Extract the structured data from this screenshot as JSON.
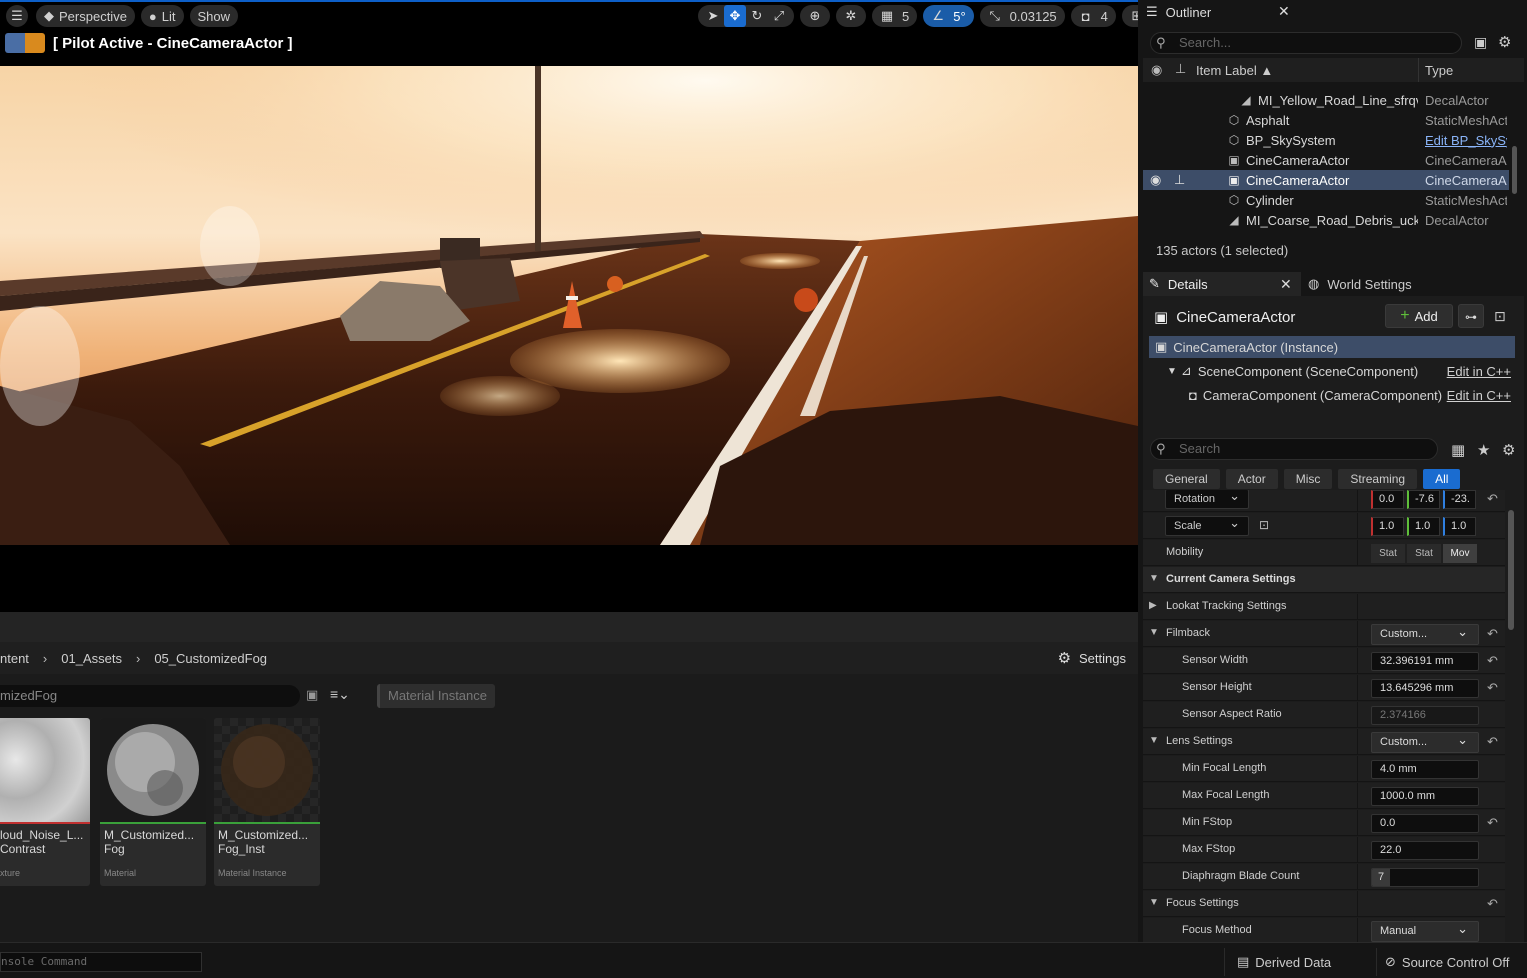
{
  "viewport": {
    "view_mode": "Perspective",
    "lighting": "Lit",
    "show": "Show",
    "grid_snap": "5",
    "rotation_snap": "5°",
    "scale_snap": "0.03125",
    "camera_speed": "4",
    "pilot_label": "[ Pilot Active - CineCameraActor ]"
  },
  "content_browser": {
    "path": [
      "ntent",
      "01_Assets",
      "05_CustomizedFog"
    ],
    "settings_label": "Settings",
    "search_value": "mizedFog",
    "filter_chip": "Material Instance",
    "assets": [
      {
        "name": "loud_Noise_L... Contrast",
        "line1": "loud_Noise_L...",
        "line2": "Contrast",
        "type": "xture",
        "bar_color": "#c03030"
      },
      {
        "name": "M_Customized... Fog",
        "line1": "M_Customized...",
        "line2": "Fog",
        "type": "Material",
        "bar_color": "#3aa03a"
      },
      {
        "name": "M_Customized... Fog_Inst",
        "line1": "M_Customized...",
        "line2": "Fog_Inst",
        "type": "Material Instance",
        "bar_color": "#3aa03a"
      }
    ]
  },
  "statusbar": {
    "console_placeholder": "nsole Command",
    "derived_data": "Derived Data",
    "source_control": "Source Control Off"
  },
  "outliner": {
    "title": "Outliner",
    "search_placeholder": "Search...",
    "col_label": "Item Label ▲",
    "col_type": "Type",
    "rows": [
      {
        "label": "MI_Yellow_Road_Line_sfrqv",
        "type": "DecalActor",
        "icon": "decal-icon"
      },
      {
        "label": "Asphalt",
        "type": "StaticMeshAct",
        "icon": "static-mesh-icon"
      },
      {
        "label": "BP_SkySystem",
        "type": "Edit BP_SkySy",
        "icon": "static-mesh-icon"
      },
      {
        "label": "CineCameraActor",
        "type": "CineCameraAc",
        "icon": "camera-icon"
      },
      {
        "label": "CineCameraActor",
        "type": "CineCameraAc",
        "icon": "camera-icon"
      },
      {
        "label": "Cylinder",
        "type": "StaticMeshAct",
        "icon": "static-mesh-icon"
      },
      {
        "label": "MI_Coarse_Road_Debris_uckl",
        "type": "DecalActor",
        "icon": "decal-icon"
      }
    ],
    "count": "135 actors (1 selected)"
  },
  "details": {
    "tab": "Details",
    "world_tab": "World Settings",
    "actor": "CineCameraActor",
    "add_label": "Add",
    "components": [
      {
        "label": "CineCameraActor (Instance)",
        "edit": ""
      },
      {
        "label": "SceneComponent (SceneComponent)",
        "edit": "Edit in C++"
      },
      {
        "label": "CameraComponent (CameraComponent)",
        "edit": "Edit in C++"
      }
    ],
    "search_placeholder": "Search",
    "filters": [
      "General",
      "Actor",
      "Misc",
      "Streaming",
      "All"
    ],
    "rotation_label": "Rotation",
    "rotation_values": [
      "0.0",
      "-7.6",
      "-23."
    ],
    "scale_label": "Scale",
    "scale_values": [
      "1.0",
      "1.0",
      "1.0"
    ],
    "mobility_label": "Mobility",
    "mobility_options": [
      "Stat",
      "Stat",
      "Mov"
    ],
    "cat_camera": "Current Camera Settings",
    "lookat": "Lookat Tracking Settings",
    "filmback": "Filmback",
    "filmback_preset": "Custom...",
    "sensor_width_label": "Sensor Width",
    "sensor_width": "32.396191 mm",
    "sensor_height_label": "Sensor Height",
    "sensor_height": "13.645296 mm",
    "aspect_label": "Sensor Aspect Ratio",
    "aspect": "2.374166",
    "lens": "Lens Settings",
    "lens_preset": "Custom...",
    "min_focal_label": "Min Focal Length",
    "min_focal": "4.0 mm",
    "max_focal_label": "Max Focal Length",
    "max_focal": "1000.0 mm",
    "min_fstop_label": "Min FStop",
    "min_fstop": "0.0",
    "max_fstop_label": "Max FStop",
    "max_fstop": "22.0",
    "blades_label": "Diaphragm Blade Count",
    "blades": "7",
    "focus": "Focus Settings",
    "focus_method_label": "Focus Method",
    "focus_method": "Manual"
  }
}
